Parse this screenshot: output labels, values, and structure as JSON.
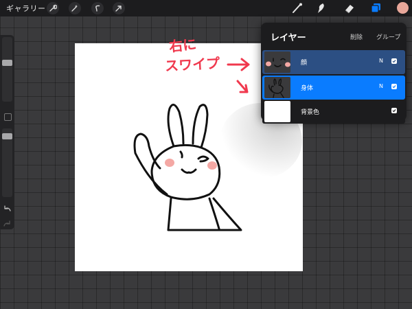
{
  "topbar": {
    "gallery_label": "ギャラリー",
    "left_tools": [
      "wrench-icon",
      "magic-wand-icon",
      "selection-icon",
      "transform-arrow-icon"
    ],
    "right_tools": [
      "brush-icon",
      "smudge-icon",
      "eraser-icon",
      "layers-icon"
    ],
    "color_swatch": "#e8a79a"
  },
  "sidebar": {
    "controls": [
      "brush-size-slider",
      "modify-button",
      "opacity-slider",
      "undo-icon",
      "redo-icon"
    ]
  },
  "layers_panel": {
    "title": "レイヤー",
    "delete_label": "削除",
    "group_label": "グループ",
    "layers": [
      {
        "name": "顔",
        "blend_mode": "N",
        "visible": true,
        "state": "multi-selected",
        "bg": "#2c4f83"
      },
      {
        "name": "身体",
        "blend_mode": "N",
        "visible": true,
        "state": "primary-selected",
        "bg": "#0a7cff"
      },
      {
        "name": "背景色",
        "blend_mode": "",
        "visible": true,
        "state": "normal",
        "bg": "#1c1c1e"
      }
    ]
  },
  "annotation": {
    "line1": "右に",
    "line2": "スワイプ",
    "color": "#f0394e"
  },
  "colors": {
    "accent_blue": "#0a7cff",
    "selected_dim_blue": "#2c4f83",
    "blush_pink": "#f4a8a4"
  }
}
